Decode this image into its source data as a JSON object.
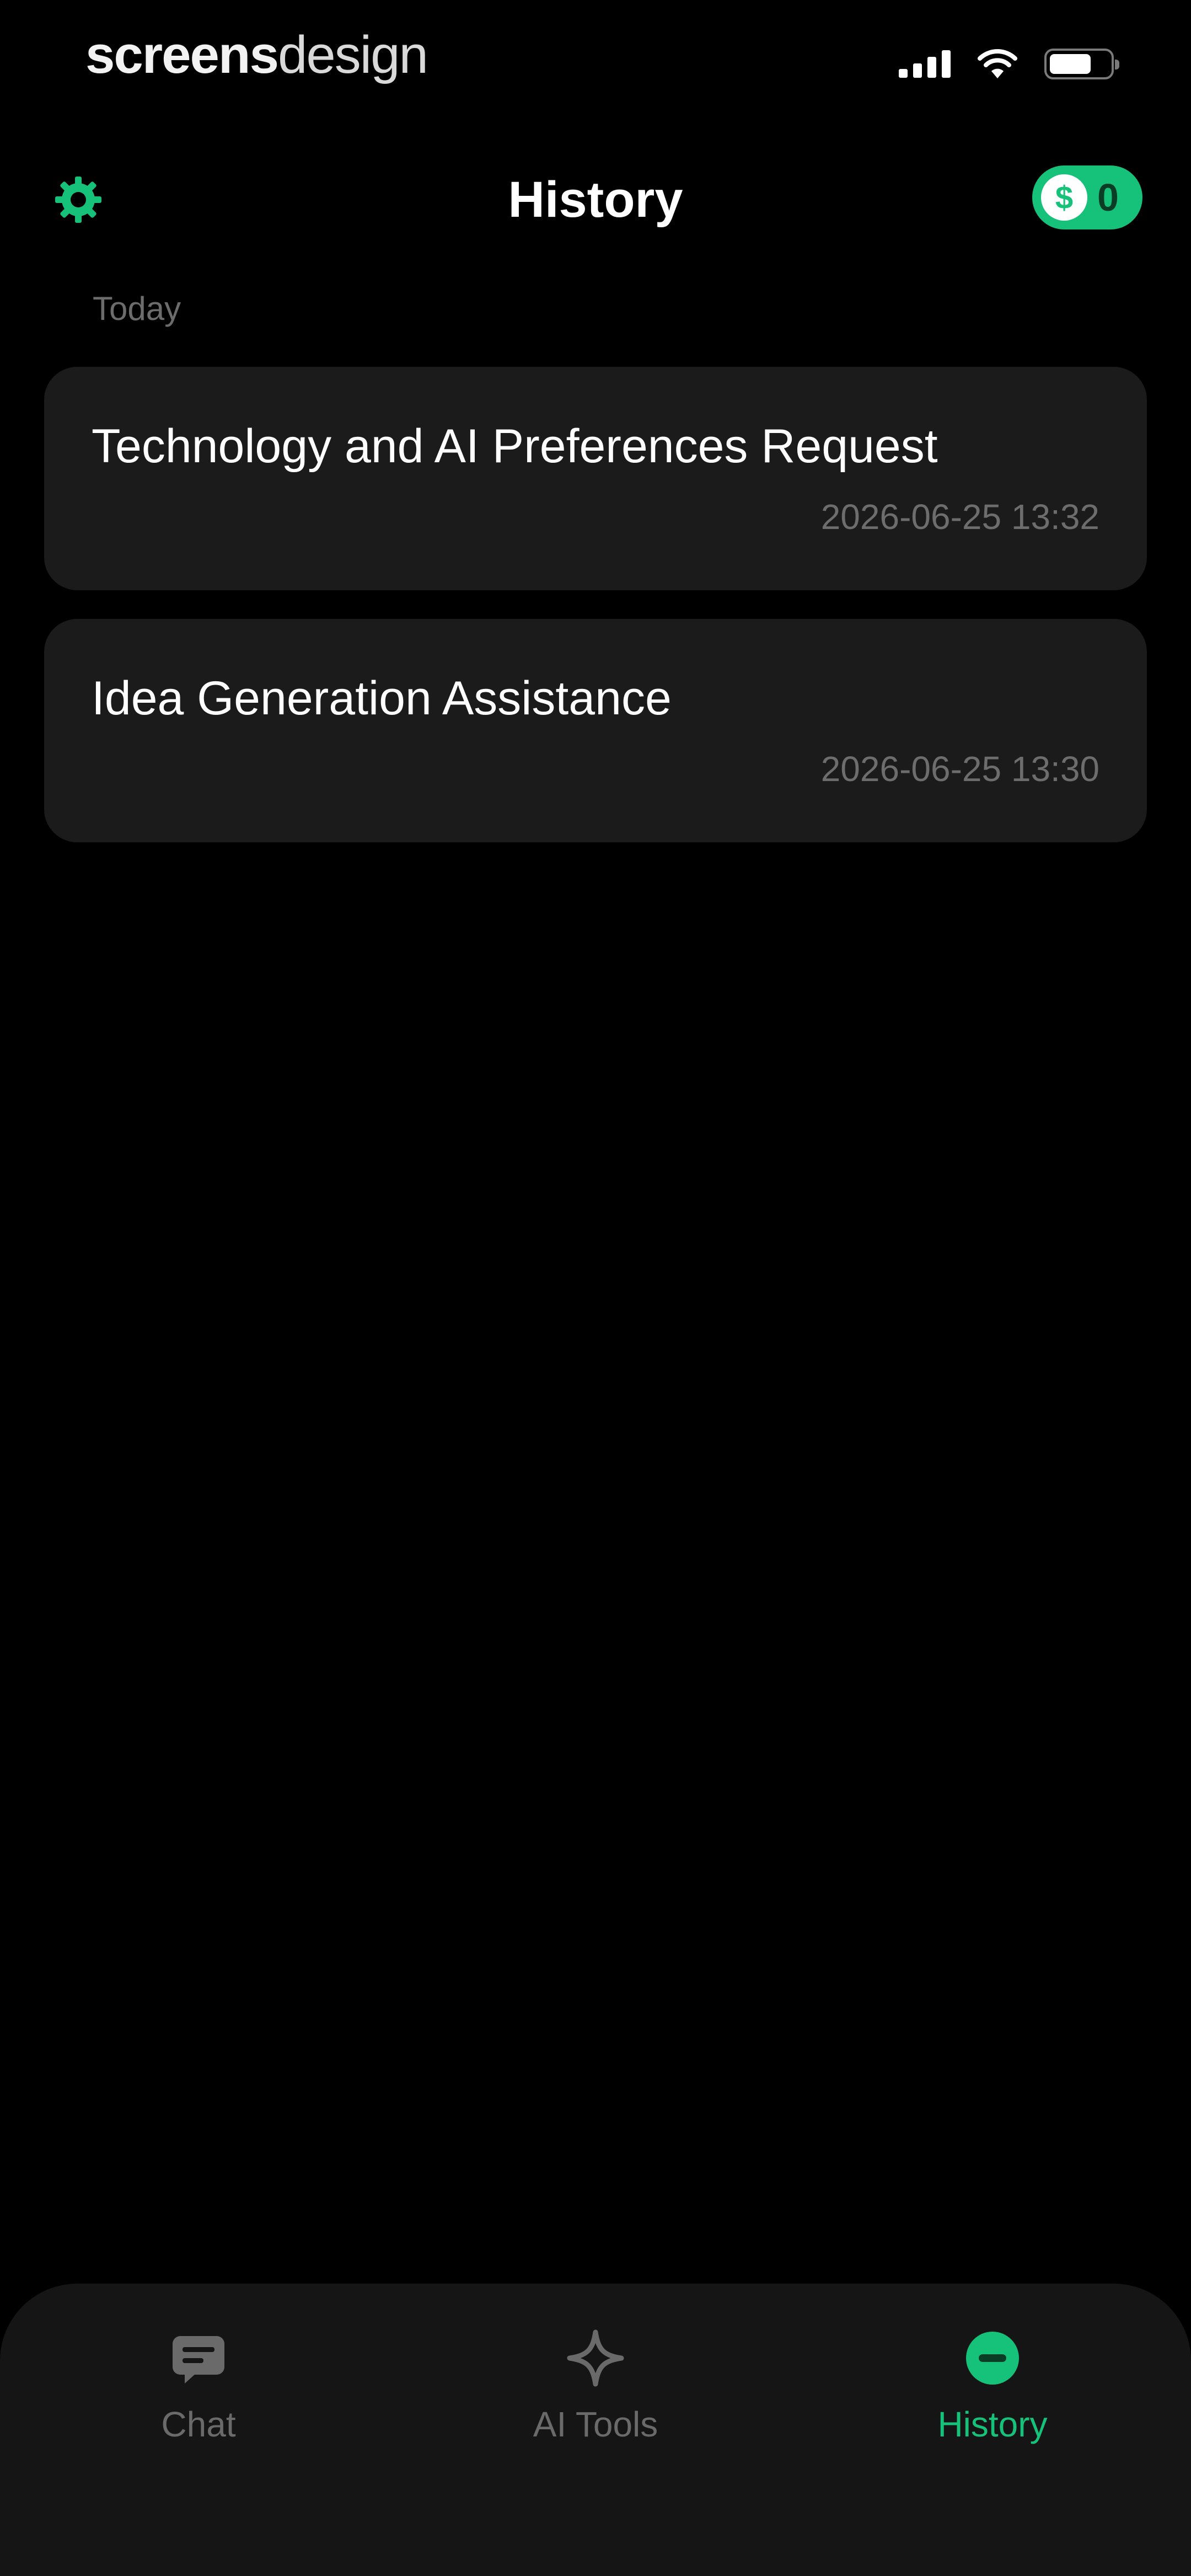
{
  "status_bar": {
    "brand_part1": "screens",
    "brand_part2": "design",
    "battery_level": 0.7
  },
  "header": {
    "title": "History",
    "credits_symbol": "$",
    "credits_count": "0",
    "settings_icon": "gear-icon"
  },
  "history": {
    "section_label": "Today",
    "items": [
      {
        "title": "Technology and AI Preferences Request",
        "timestamp": "2026-06-25 13:32"
      },
      {
        "title": "Idea Generation Assistance",
        "timestamp": "2026-06-25 13:30"
      }
    ]
  },
  "tabbar": {
    "tabs": [
      {
        "label": "Chat",
        "icon": "chat-icon",
        "active": false
      },
      {
        "label": "AI Tools",
        "icon": "sparkle-icon",
        "active": false
      },
      {
        "label": "History",
        "icon": "history-icon",
        "active": true
      }
    ]
  },
  "colors": {
    "accent": "#16c27a",
    "background": "#000000",
    "card": "#1b1b1b",
    "muted_text": "#6d6d6d"
  }
}
